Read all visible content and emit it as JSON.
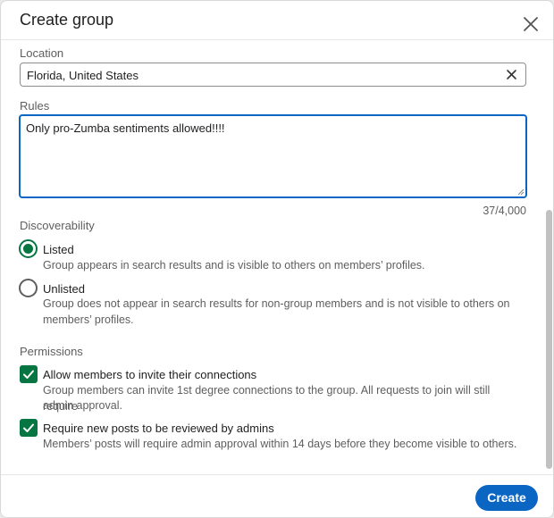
{
  "dialog": {
    "title": "Create group"
  },
  "location": {
    "label": "Location",
    "value": "Florida, United States"
  },
  "rules": {
    "label": "Rules",
    "value": "Only pro-Zumba sentiments allowed!!!!",
    "counter": "37/4,000"
  },
  "discoverability": {
    "label": "Discoverability",
    "options": [
      {
        "title": "Listed",
        "description": "Group appears in search results and is visible to others on members’ profiles.",
        "selected": true
      },
      {
        "title": "Unlisted",
        "description_line1": "Group does not appear in search results for non-group members and is not visible to others on",
        "description_line2": "members’ profiles.",
        "selected": false
      }
    ]
  },
  "permissions": {
    "label": "Permissions",
    "options": [
      {
        "title": "Allow members to invite their connections",
        "description_line1": "Group members can invite 1st degree connections to the group. All requests to join will still require",
        "description_line2": "admin approval.",
        "checked": true
      },
      {
        "title": "Require new posts to be reviewed by admins",
        "description": "Members’ posts will require admin approval within 14 days before they become visible to others.",
        "checked": true
      }
    ]
  },
  "footer": {
    "create_label": "Create"
  },
  "colors": {
    "primary": "#0a66c2",
    "accent_green": "#057642",
    "muted_text": "#5e5e5e"
  },
  "icons": {
    "close": "close-icon",
    "clear": "clear-icon",
    "check": "check-icon"
  }
}
